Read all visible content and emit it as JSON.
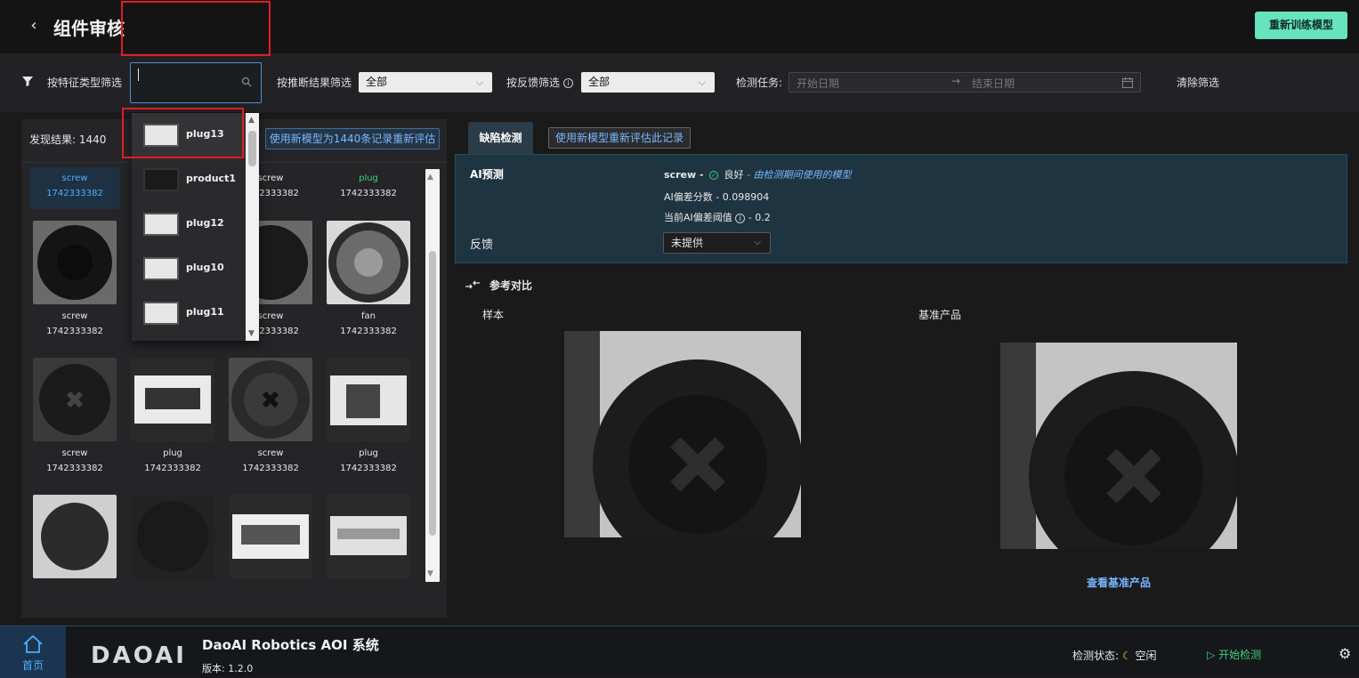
{
  "header": {
    "back_glyph": "‹",
    "title": "组件审核",
    "retrain_button": "重新训练模型"
  },
  "filters": {
    "feature_type_label": "按特征类型筛选",
    "feature_type_value": "",
    "inference_label": "按推断结果筛选",
    "inference_value": "全部",
    "feedback_label": "按反馈筛选",
    "feedback_value": "全部",
    "task_label": "检测任务:",
    "start_date_placeholder": "开始日期",
    "end_date_placeholder": "结束日期",
    "clear_button": "清除筛选"
  },
  "left_panel": {
    "found_label": "发现结果: 1440",
    "reevaluate_all_button": "使用新模型为1440条记录重新评估",
    "items": [
      {
        "name": "screw",
        "stamp": "1742333382",
        "selected": true
      },
      {
        "name": "",
        "stamp": "",
        "selected": false
      },
      {
        "name": "screw",
        "stamp": "1742333382",
        "selected": false
      },
      {
        "name": "plug",
        "stamp": "1742333382",
        "selected": false
      },
      {
        "name": "screw",
        "stamp": "1742333382",
        "selected": false
      },
      {
        "name": "",
        "stamp": "",
        "selected": false
      },
      {
        "name": "screw",
        "stamp": "1742333382",
        "selected": false
      },
      {
        "name": "fan",
        "stamp": "1742333382",
        "selected": false
      },
      {
        "name": "screw",
        "stamp": "1742333382",
        "selected": false
      },
      {
        "name": "plug",
        "stamp": "1742333382",
        "selected": false
      },
      {
        "name": "screw",
        "stamp": "1742333382",
        "selected": false
      },
      {
        "name": "plug",
        "stamp": "1742333382",
        "selected": false
      }
    ]
  },
  "dropdown": {
    "options": [
      "plug13",
      "product1",
      "plug12",
      "plug10",
      "plug11"
    ],
    "highlighted": "plug13"
  },
  "detail": {
    "tab_label": "缺陷检测",
    "reevaluate_one_button": "使用新模型重新评估此记录",
    "ai_label": "AI预测",
    "prediction_class": "screw -",
    "prediction_result": "良好",
    "prediction_model": "- 由检测期间使用的模型",
    "score_line": "AI偏差分数 - 0.098904",
    "threshold_label": "当前AI偏差阈值",
    "threshold_value": "- 0.2",
    "feedback_label": "反馈",
    "feedback_value": "未提供",
    "compare_title": "参考对比",
    "sample_label": "样本",
    "base_label": "基准产品",
    "view_base_link": "查看基准产品"
  },
  "footer": {
    "home_label": "首页",
    "logo_text": "DAOAI",
    "system_name": "DaoAI Robotics AOI 系统",
    "version": "版本: 1.2.0",
    "status_label": "检测状态:",
    "status_value": "空闲",
    "start_button": "开始检测"
  },
  "colors": {
    "accent": "#67e3be",
    "link": "#79b8ff",
    "ok": "#3ccf7e",
    "highlight_box": "#e11d26"
  }
}
